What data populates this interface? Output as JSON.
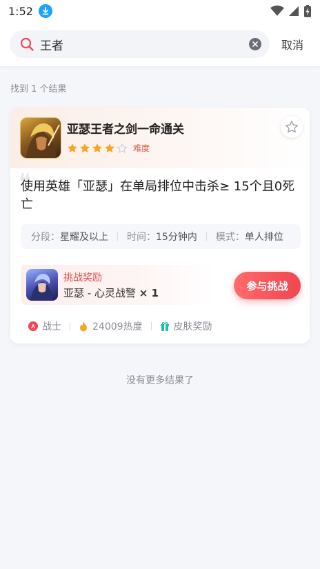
{
  "status_bar": {
    "time": "1:52",
    "icons": [
      "download-icon",
      "wifi-icon",
      "signal-icon",
      "battery-icon"
    ]
  },
  "search": {
    "value": "王者",
    "cancel_label": "取消"
  },
  "results_count": "找到 1 个结果",
  "card": {
    "title": "亚瑟王者之剑一命通关",
    "rating": 4,
    "rating_max": 5,
    "difficulty_label": "难度",
    "description": "使用英雄「亚瑟」在单局排位中击杀≥ 15个且0死亡",
    "info": [
      {
        "key": "分段：",
        "value": "星耀及以上"
      },
      {
        "key": "时间：",
        "value": "15分钟内"
      },
      {
        "key": "模式：",
        "value": "单人排位"
      }
    ],
    "reward": {
      "label": "挑战奖励",
      "item": "亚瑟 - 心灵战警",
      "quantity": "× 1"
    },
    "join_label": "参与挑战",
    "tags": [
      {
        "icon": "role-icon",
        "text": "战士"
      },
      {
        "icon": "fire-icon",
        "text": "24009热度"
      },
      {
        "icon": "gift-icon",
        "text": "皮肤奖励"
      }
    ]
  },
  "footer_text": "没有更多结果了",
  "colors": {
    "accent": "#f2454f",
    "star": "#f5a623",
    "download_icon": "#1aa3ff"
  }
}
